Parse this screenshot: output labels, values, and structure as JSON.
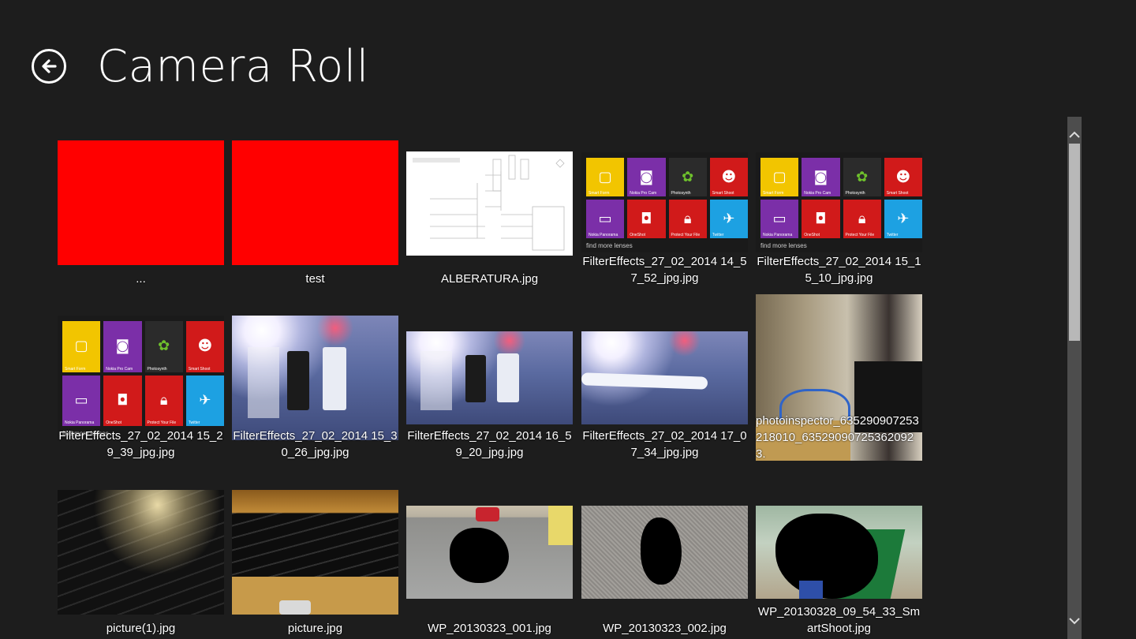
{
  "header": {
    "title": "Camera Roll",
    "back_icon": "back-arrow-icon"
  },
  "tiles": [
    {
      "caption": "...",
      "kind": "red"
    },
    {
      "caption": "test",
      "kind": "red"
    },
    {
      "caption": "ALBERATURA.jpg",
      "kind": "document"
    },
    {
      "caption": "FilterEffects_27_02_2014 14_57_52_jpg.jpg",
      "kind": "lenses"
    },
    {
      "caption": "FilterEffects_27_02_2014 15_15_10_jpg.jpg",
      "kind": "lenses"
    },
    {
      "caption": "FilterEffects_27_02_2014 15_29_39_jpg.jpg",
      "kind": "lenses"
    },
    {
      "caption": "FilterEffects_27_02_2014 15_30_26_jpg.jpg",
      "kind": "photo"
    },
    {
      "caption": "FilterEffects_27_02_2014 16_59_20_jpg.jpg",
      "kind": "photo"
    },
    {
      "caption": "FilterEffects_27_02_2014 17_07_34_jpg.jpg",
      "kind": "photo"
    },
    {
      "caption": "photoinspector_635290907253218010_635290907253620923.",
      "kind": "photo"
    },
    {
      "caption": "picture(1).jpg",
      "kind": "photo"
    },
    {
      "caption": "picture.jpg",
      "kind": "photo"
    },
    {
      "caption": "WP_20130323_001.jpg",
      "kind": "photo"
    },
    {
      "caption": "WP_20130323_002.jpg",
      "kind": "photo"
    },
    {
      "caption": "WP_20130328_09_54_33_SmartShoot.jpg",
      "kind": "photo"
    }
  ],
  "lenses": {
    "items": [
      {
        "label": "Smart Form",
        "color": "#f2c500",
        "icon": "frame-icon"
      },
      {
        "label": "Nokia Pro Cam",
        "color": "#7b2fa8",
        "icon": "camera-icon"
      },
      {
        "label": "Photosynth",
        "color": "#2b2b2b",
        "icon": "leaf-icon"
      },
      {
        "label": "Smart Shoot",
        "color": "#d11a1a",
        "icon": "faces-icon"
      },
      {
        "label": "Nokia Panorama",
        "color": "#7b2fa8",
        "icon": "panorama-icon"
      },
      {
        "label": "OneShot",
        "color": "#d11a1a",
        "icon": "oneshot-icon"
      },
      {
        "label": "Protect Your File",
        "color": "#d11a1a",
        "icon": "lock-icon"
      },
      {
        "label": "Twitter",
        "color": "#1da1e2",
        "icon": "twitter-icon"
      }
    ],
    "more": "find more lenses"
  },
  "scrollbar": {
    "up_icon": "chevron-up-icon",
    "down_icon": "chevron-down-icon"
  }
}
